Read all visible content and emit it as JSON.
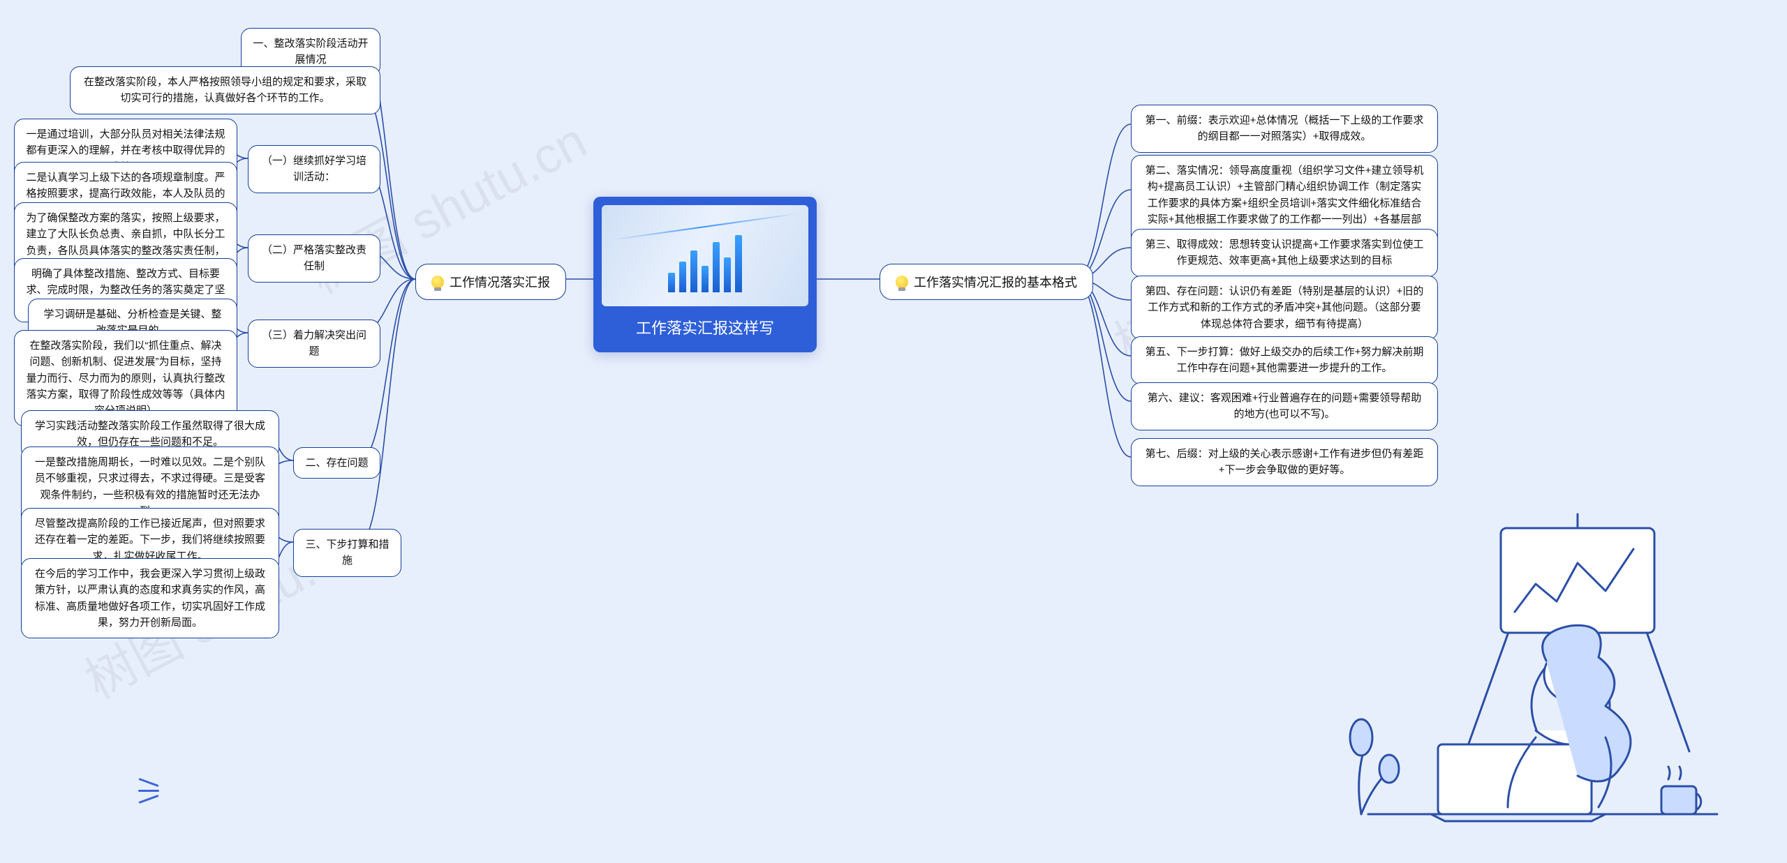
{
  "root": {
    "title": "工作落实汇报这样写"
  },
  "left_branch": {
    "label": "工作情况落实汇报"
  },
  "right_branch": {
    "label": "工作落实情况汇报的基本格式"
  },
  "left": {
    "n1": "一、整改落实阶段活动开展情况",
    "n2": "在整改落实阶段，本人严格按照领导小组的规定和要求，采取切实可行的措施，认真做好各个环节的工作。",
    "s1": "（一）继续抓好学习培训活动：",
    "s1a": "一是通过培训，大部分队员对相关法律法规都有更深入的理解，并在考核中取得优异的成绩；",
    "s1b": "二是认真学习上级下达的各项规章制度。严格按照要求，提高行政效能，本人及队员的整体素质得到提升。",
    "s2": "（二）严格落实整改责任制",
    "s2a": "为了确保整改方案的落实，按照上级要求，建立了大队长负总责、亲自抓，中队长分工负责，各队员具体落实的整改落实责任制，确定了整改落实的监督保障机制。",
    "s2b": "明确了具体整改措施、整改方式、目标要求、完成时限，为整改任务的落实奠定了坚实基础。",
    "s3": "（三）着力解决突出问题",
    "s3a": "学习调研是基础、分析检查是关键、整改落实是目的。",
    "s3b": "在整改落实阶段，我们以“抓住重点、解决问题、创新机制、促进发展”为目标，坚持量力而行、尽力而为的原则，认真执行整改落实方案，取得了阶段性成效等等（具体内容分项说明）",
    "n3": "二、存在问题",
    "n3a": "学习实践活动整改落实阶段工作虽然取得了很大成效，但仍存在一些问题和不足。",
    "n3b": "一是整改措施周期长，一时难以见效。二是个别队员不够重视，只求过得去，不求过得硬。三是受客观条件制约，一些积极有效的措施暂时还无法办到。",
    "n4": "三、下步打算和措施",
    "n4a": "尽管整改提高阶段的工作已接近尾声，但对照要求还存在着一定的差距。下一步，我们将继续按照要求，扎实做好收尾工作。",
    "n4b": "在今后的学习工作中，我会更深入学习贯彻上级政策方针，以严肃认真的态度和求真务实的作风，高标准、高质量地做好各项工作，切实巩固好工作成果，努力开创新局面。"
  },
  "right": {
    "r1": "第一、前缀：表示欢迎+总体情况（概括一下上级的工作要求的纲目都一一对照落实）+取得成效。",
    "r2": "第二、落实情况：领导高度重视（组织学习文件+建立领导机构+提高员工认识）+主管部门精心组织协调工作（制定落实工作要求的具体方案+组织全员培训+落实文件细化标准结合实际+其他根据工作要求做了的工作都一一列出）+各基层部门落实方案（统一认识+稳步推进）",
    "r3": "第三、取得成效：思想转变认识提高+工作要求落实到位使工作更规范、效率更高+其他上级要求达到的目标",
    "r4": "第四、存在问题：认识仍有差距（特别是基层的认识）+旧的工作方式和新的工作方式的矛盾冲突+其他问题。（这部分要体现总体符合要求，细节有待提高）",
    "r5": "第五、下一步打算：做好上级交办的后续工作+努力解决前期工作中存在问题+其他需要进一步提升的工作。",
    "r6": "第六、建议：客观困难+行业普遍存在的问题+需要领导帮助的地方(也可以不写)。",
    "r7": "第七、后缀：对上级的关心表示感谢+工作有进步但仍有差距+下一步会争取做的更好等。"
  },
  "watermarks": {
    "w1": "树图 shutu.cn",
    "w2": "树图 shutu.cn",
    "w3": "树图 shutu"
  }
}
